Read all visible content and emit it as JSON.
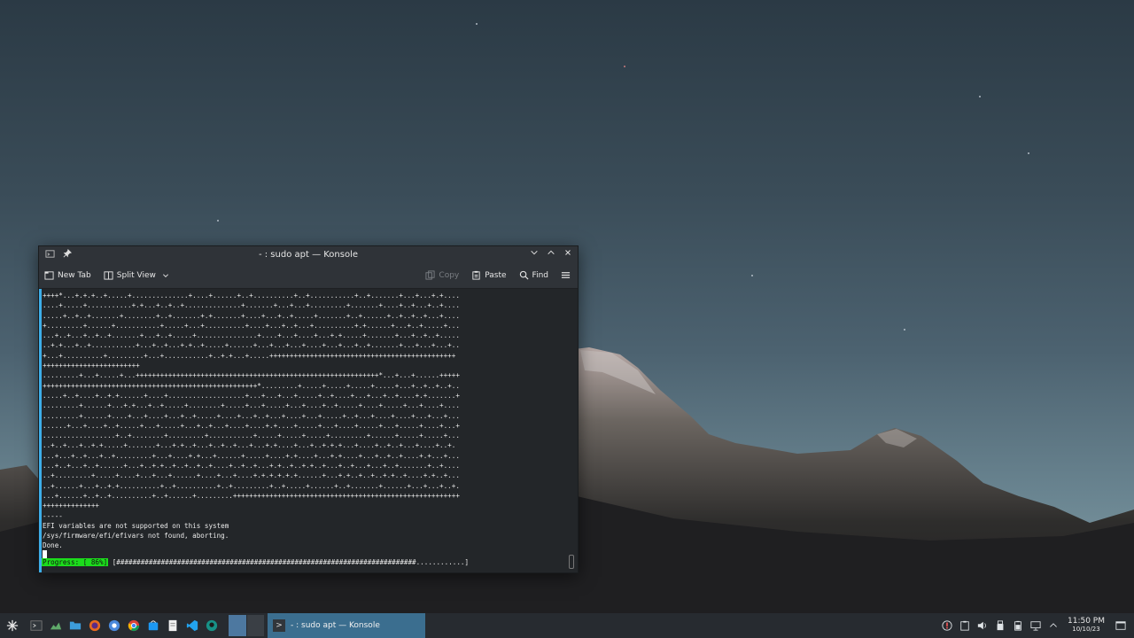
{
  "window": {
    "title": "- : sudo apt — Konsole",
    "toolbar": {
      "new_tab": "New Tab",
      "split_view": "Split View",
      "copy": "Copy",
      "paste": "Paste",
      "find": "Find"
    }
  },
  "terminal": {
    "lines": [
      "++++*...+.+.+..+.....+..............+....+......+..+..........+..+...........+..+.......+...+...+.+....",
      "....+.....+...........+.+...+..+..+..............+.......+...+...+.........+.......+....+..+...+..+....",
      ".....+..+..+.......+........+..+.......+.+.......+....+...+..+.....+.......+..+......+..+..+..+...+....",
      "+.........+......+...........+.....+...+..........+....+...+..+...+..........+.+......+...+..+.....+...",
      "...+..+...+..+..+.......+...+..+.....+...............+....+...+....+...+.+.....+.......+...+..+..+.....",
      "..+.+...+..+...........+...+..+...+.+..+.....+......+...+...+...+....+...+...+..+.......+...+...+...+..",
      "+...+..........+.........+...+...........+..+.+...+.....++++++++++++++++++++++++++++++++++++++++++++++",
      "++++++++++++++++++++++++",
      ".........+...+.....+...++++++++++++++++++++++++++++++++++++++++++++++++++++++++++++*...+...+......+++++",
      "+++++++++++++++++++++++++++++++++++++++++++++++++++++*.........+.....+.....+.....+.....+...+..+..+..+..",
      ".....+..+....+..+.+......+....+...................+...+...+...+.....+..+....+...+...+..+....+.+.......+",
      ".........+......+...+.+...+..+.....+........+.....+...+.....+...+....+..+.....+....+.....+...+....+....",
      ".........+......+....+...+....+...+..+.....+....+...+..+...+....+...+.....+..+...+....+....+...+...+...",
      "......+...+....+..+.....+...+.....+...+..+...+....+....+.+....+.....+...+....+.....+...+.....+....+...+",
      "..................+..+........+.........+...........+.....+.....+.....+.........+......+.....+.....+...",
      "..+..+...+..+.+.....+.......+...+.+..+...+..+..+...+...+.+....+...+..+.+.+...+....+..+..+...+....+..+.",
      "...+...+..+...+..+.........+...+....+.+...+......+.....+....+.+....+...+.+....+...+..+..+....+.+...+...",
      "...+..+...+..+......+...+..+.+..+..+..+..+....+..+..+...+.+..+..+.+..+...+..+...+...+..+.......+..+....",
      "..+.........+.....+....+...+...+......+....+...+....+.+.+.+.+.+......+...+.+..+..+..+.+..+....+.+..+...",
      "..+......+...+..+.+..........+..+..........+..+.........+..+.....+......+..+.......+......+...+...+..+.",
      "...+......+..+..+..........+..+......+.........++++++++++++++++++++++++++++++++++++++++++++++++++++++++",
      "++++++++++++++",
      "-----",
      "EFI variables are not supported on this system",
      "/sys/firmware/efi/efivars not found, aborting.",
      "Done."
    ],
    "progress_label": "Progress: [ 86%]",
    "progress_value": 0.86,
    "progress_bar": " [##########################################################################............]"
  },
  "taskbar": {
    "task_title": "- : sudo apt — Konsole",
    "clock_time": "11:50 PM",
    "clock_date": "10/10/23"
  },
  "colors": {
    "accent": "#3daee9",
    "progress": "#1cdc1c",
    "task_active": "#3b6e8f"
  }
}
